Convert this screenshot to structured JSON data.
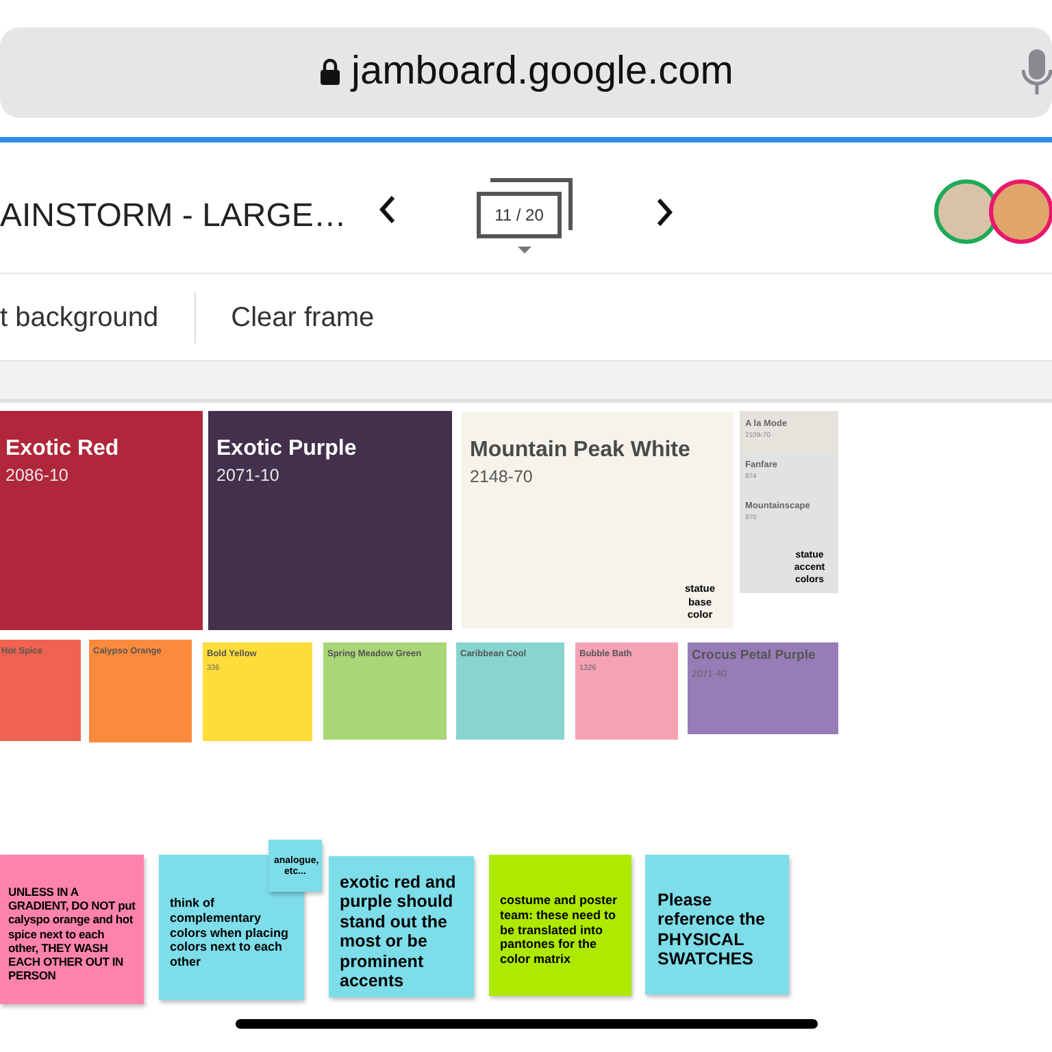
{
  "browser": {
    "url": "jamboard.google.com"
  },
  "header": {
    "title": "AINSTORM - LARGE…",
    "frame_counter": "11 / 20"
  },
  "toolbar": [
    "t background",
    "Clear frame"
  ],
  "swatches": [
    {
      "kind": "large",
      "name": "Exotic Red",
      "code": "2086-10",
      "color": "#b0263a"
    },
    {
      "kind": "large",
      "name": "Exotic Purple",
      "code": "2071-10",
      "color": "#42304c"
    },
    {
      "kind": "large",
      "name": "Mountain Peak White",
      "code": "2148-70",
      "color": "#f5f3ea",
      "note": "statue base color"
    },
    {
      "kind": "panel",
      "color": "#e1e3e1",
      "note": "statue accent colors",
      "chips": [
        {
          "name": "A la Mode",
          "code": "2109-70",
          "color": "#e6e3dd"
        },
        {
          "name": "Fanfare",
          "code": "874",
          "color": "#e0e3e1"
        },
        {
          "name": "Mountainscape",
          "code": "870",
          "color": "#e1e3e1"
        }
      ]
    }
  ],
  "small_swatches": [
    {
      "name": "Hot Spice",
      "color": "#f06350"
    },
    {
      "name": "Calypso Orange",
      "color": "#fc8a3c"
    },
    {
      "name": "Bold Yellow",
      "code": "336",
      "color": "#fedc3a"
    },
    {
      "name": "Spring Meadow Green",
      "color": "#a9d676"
    },
    {
      "name": "Caribbean Cool",
      "color": "#88d5cf"
    },
    {
      "name": "Bubble Bath",
      "code": "1326",
      "color": "#f5a2b5"
    },
    {
      "name": "Crocus Petal Purple",
      "code": "2071-40",
      "color": "#977db7"
    }
  ],
  "sticky_notes": [
    {
      "text": "UNLESS IN A GRADIENT, DO NOT put calyspo orange and hot spice next to each other, THEY WASH EACH OTHER OUT IN PERSON",
      "color": "#fd83ad"
    },
    {
      "text": "think of complementary colors when placing colors next to each other",
      "color": "#7ddde9"
    },
    {
      "text": "analogue, etc...",
      "color": "#7ddde9"
    },
    {
      "text": "exotic red and purple should stand out the most or be prominent accents",
      "color": "#7ddde9"
    },
    {
      "text": "costume and poster team: these need to be translated into pantones for the color matrix",
      "color": "#aee900"
    },
    {
      "text": "Please reference the PHYSICAL SWATCHES",
      "color": "#7ddde9"
    }
  ]
}
